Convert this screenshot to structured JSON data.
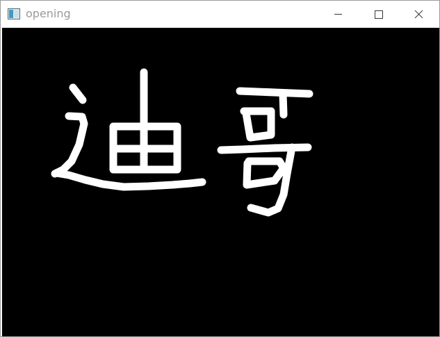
{
  "window": {
    "title": "opening"
  },
  "icons": {
    "app": "window-app-icon",
    "minimize": "minimize-icon",
    "maximize": "maximize-icon",
    "close": "close-icon"
  },
  "image": {
    "text": "迪哥"
  },
  "colors": {
    "titlebar_bg": "#ffffff",
    "title_text": "#9a9a9a",
    "canvas_bg": "#000000",
    "stroke": "#ffffff"
  }
}
